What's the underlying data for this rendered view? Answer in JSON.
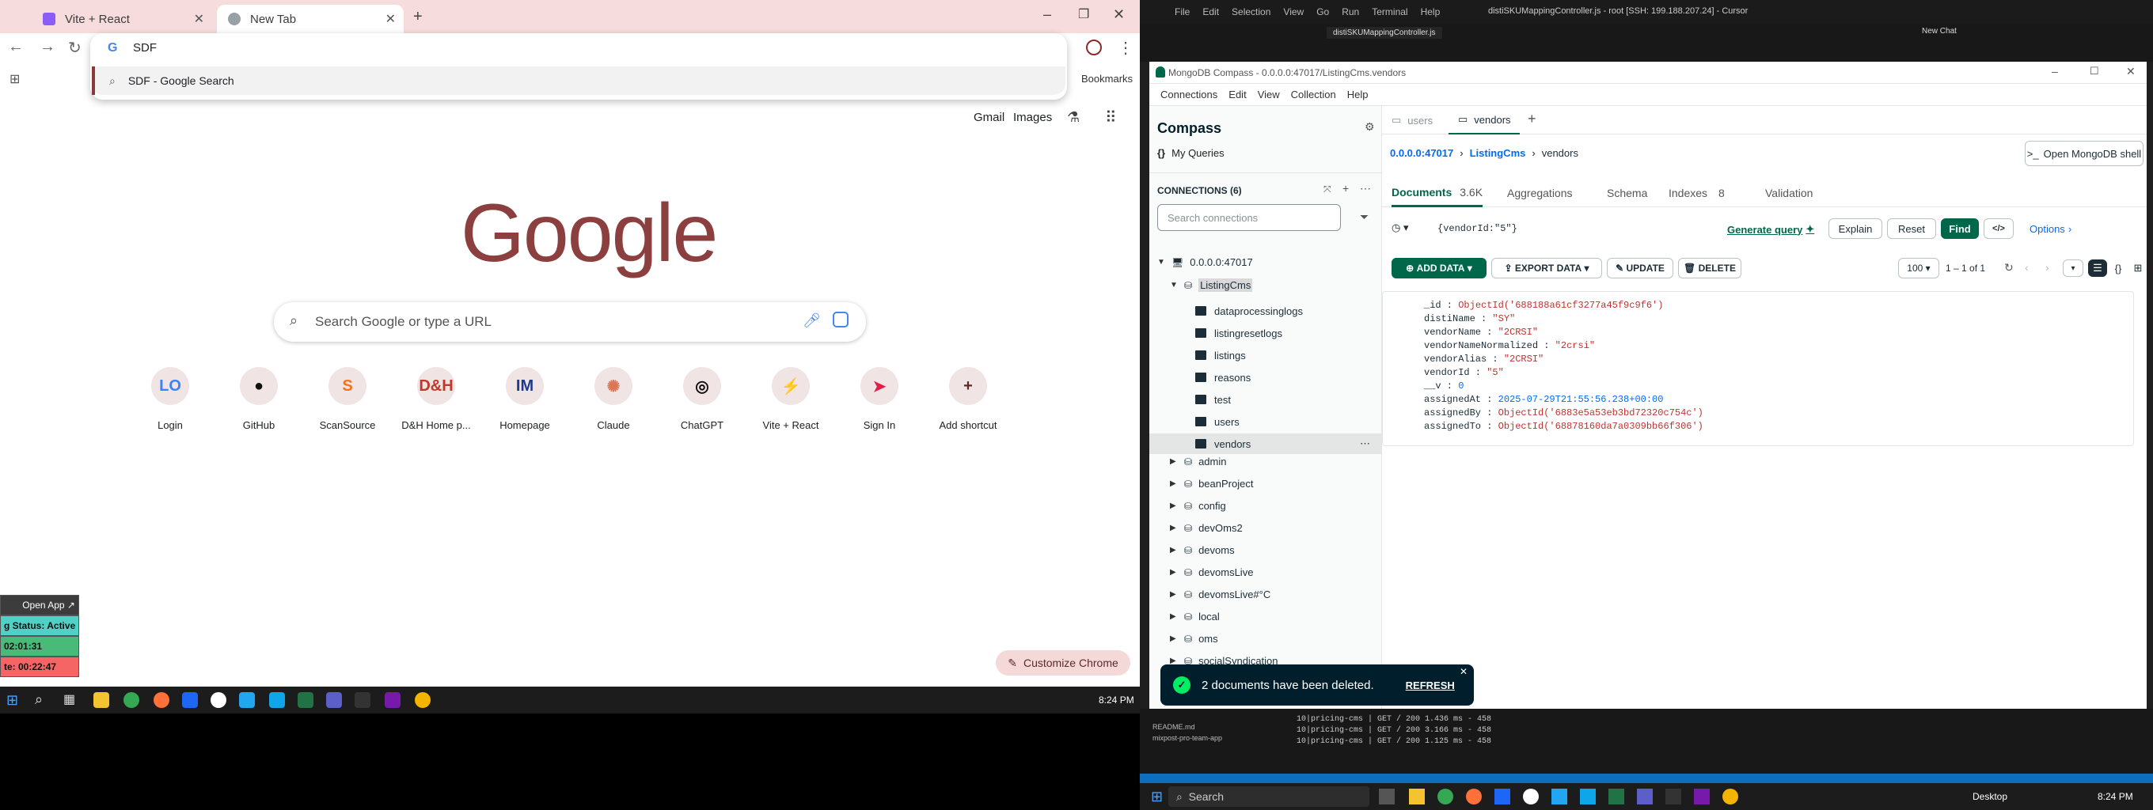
{
  "chrome": {
    "tabs": [
      {
        "title": "Vite + React"
      },
      {
        "title": "New Tab"
      }
    ],
    "omnibox": {
      "value": "SDF",
      "suggestion": "SDF - Google Search"
    },
    "bookmarks_label": "Bookmarks",
    "links": {
      "gmail": "Gmail",
      "images": "Images"
    },
    "logo": "Google",
    "search_placeholder": "Search Google or type a URL",
    "shortcuts": [
      {
        "label": "Login",
        "glyph": "LO",
        "color": "#3b82f6"
      },
      {
        "label": "GitHub",
        "glyph": "●",
        "color": "#111111"
      },
      {
        "label": "ScanSource",
        "glyph": "S",
        "color": "#f97316"
      },
      {
        "label": "D&H Home p...",
        "glyph": "D&H",
        "color": "#c0392b"
      },
      {
        "label": "Homepage",
        "glyph": "IM",
        "color": "#1e3a8a"
      },
      {
        "label": "Claude",
        "glyph": "✺",
        "color": "#d97757"
      },
      {
        "label": "ChatGPT",
        "glyph": "◎",
        "color": "#111111"
      },
      {
        "label": "Vite + React",
        "glyph": "⚡",
        "color": "#8b5cf6"
      },
      {
        "label": "Sign In",
        "glyph": "➤",
        "color": "#e11d48"
      },
      {
        "label": "Add shortcut",
        "glyph": "+",
        "color": "#5a2a2a"
      }
    ],
    "customize_label": "Customize Chrome"
  },
  "widget": {
    "open_app": "Open App ↗",
    "status": "g Status: Active",
    "time1": "02:01:31",
    "time2": "te: 00:22:47"
  },
  "taskbar_left": {
    "time": "8:24 PM"
  },
  "cursor": {
    "menu": [
      "File",
      "Edit",
      "Selection",
      "View",
      "Go",
      "Run",
      "Terminal",
      "Help"
    ],
    "title": "distiSKUMappingController.js - root [SSH: 199.188.207.24] - Cursor",
    "active_file": "distiSKUMappingController.js",
    "new_chat": "New Chat"
  },
  "compass": {
    "window_title": "MongoDB Compass - 0.0.0.0:47017/ListingCms.vendors",
    "menu": [
      "Connections",
      "Edit",
      "View",
      "Collection",
      "Help"
    ],
    "brand": "Compass",
    "my_queries": "My Queries",
    "connections_label": "CONNECTIONS (6)",
    "search_connections": "Search connections",
    "connection": "0.0.0.0:47017",
    "active_db": "ListingCms",
    "collections": [
      "dataprocessinglogs",
      "listingresetlogs",
      "listings",
      "reasons",
      "test",
      "users",
      "vendors"
    ],
    "databases": [
      "admin",
      "beanProject",
      "config",
      "devOms2",
      "devoms",
      "devomsLive",
      "devomsLive#°C",
      "local",
      "oms",
      "socialSyndication"
    ],
    "tabs": [
      "users",
      "vendors"
    ],
    "breadcrumb": {
      "host": "0.0.0.0:47017",
      "db": "ListingCms",
      "coll": "vendors"
    },
    "open_shell": "Open MongoDB shell",
    "subtabs": {
      "documents": "Documents",
      "doc_count": "3.6K",
      "aggregations": "Aggregations",
      "schema": "Schema",
      "indexes": "Indexes",
      "index_count": "8",
      "validation": "Validation"
    },
    "query": "{vendorId:\"5\"}",
    "generate_query": "Generate query",
    "explain": "Explain",
    "reset": "Reset",
    "find": "Find",
    "options": "Options",
    "add_data": "ADD DATA",
    "export_data": "EXPORT DATA",
    "update": "UPDATE",
    "delete": "DELETE",
    "page_size": "100",
    "range": "1 – 1 of 1",
    "document": [
      {
        "key": "_id",
        "value": "ObjectId('688188a61cf3277a45f9c9f6')",
        "kind": "id"
      },
      {
        "key": "distiName",
        "value": "\"SY\"",
        "kind": "str"
      },
      {
        "key": "vendorName",
        "value": "\"2CRSI\"",
        "kind": "str"
      },
      {
        "key": "vendorNameNormalized",
        "value": "\"2crsi\"",
        "kind": "str"
      },
      {
        "key": "vendorAlias",
        "value": "\"2CRSI\"",
        "kind": "str"
      },
      {
        "key": "vendorId",
        "value": "\"5\"",
        "kind": "str"
      },
      {
        "key": "__v",
        "value": "0",
        "kind": "num"
      },
      {
        "key": "assignedAt",
        "value": "2025-07-29T21:55:56.238+00:00",
        "kind": "date"
      },
      {
        "key": "assignedBy",
        "value": "ObjectId('6883e5a53eb3bd72320c754c')",
        "kind": "id"
      },
      {
        "key": "assignedTo",
        "value": "ObjectId('68878160da7a0309bb66f306')",
        "kind": "id"
      }
    ],
    "toast": {
      "message": "2 documents have been deleted.",
      "action": "REFRESH"
    }
  },
  "terminal": {
    "lines": [
      "10|pricing-cms  | GET / 200 1.436 ms - 458",
      "10|pricing-cms  | GET / 200 3.166 ms - 458",
      "10|pricing-cms  | GET / 200 1.125 ms - 458"
    ],
    "explorer": [
      "README.md",
      "mixpost-pro-team-app"
    ]
  },
  "taskbar_right": {
    "search": "Search",
    "desktop": "Desktop",
    "time": "8:24 PM"
  }
}
